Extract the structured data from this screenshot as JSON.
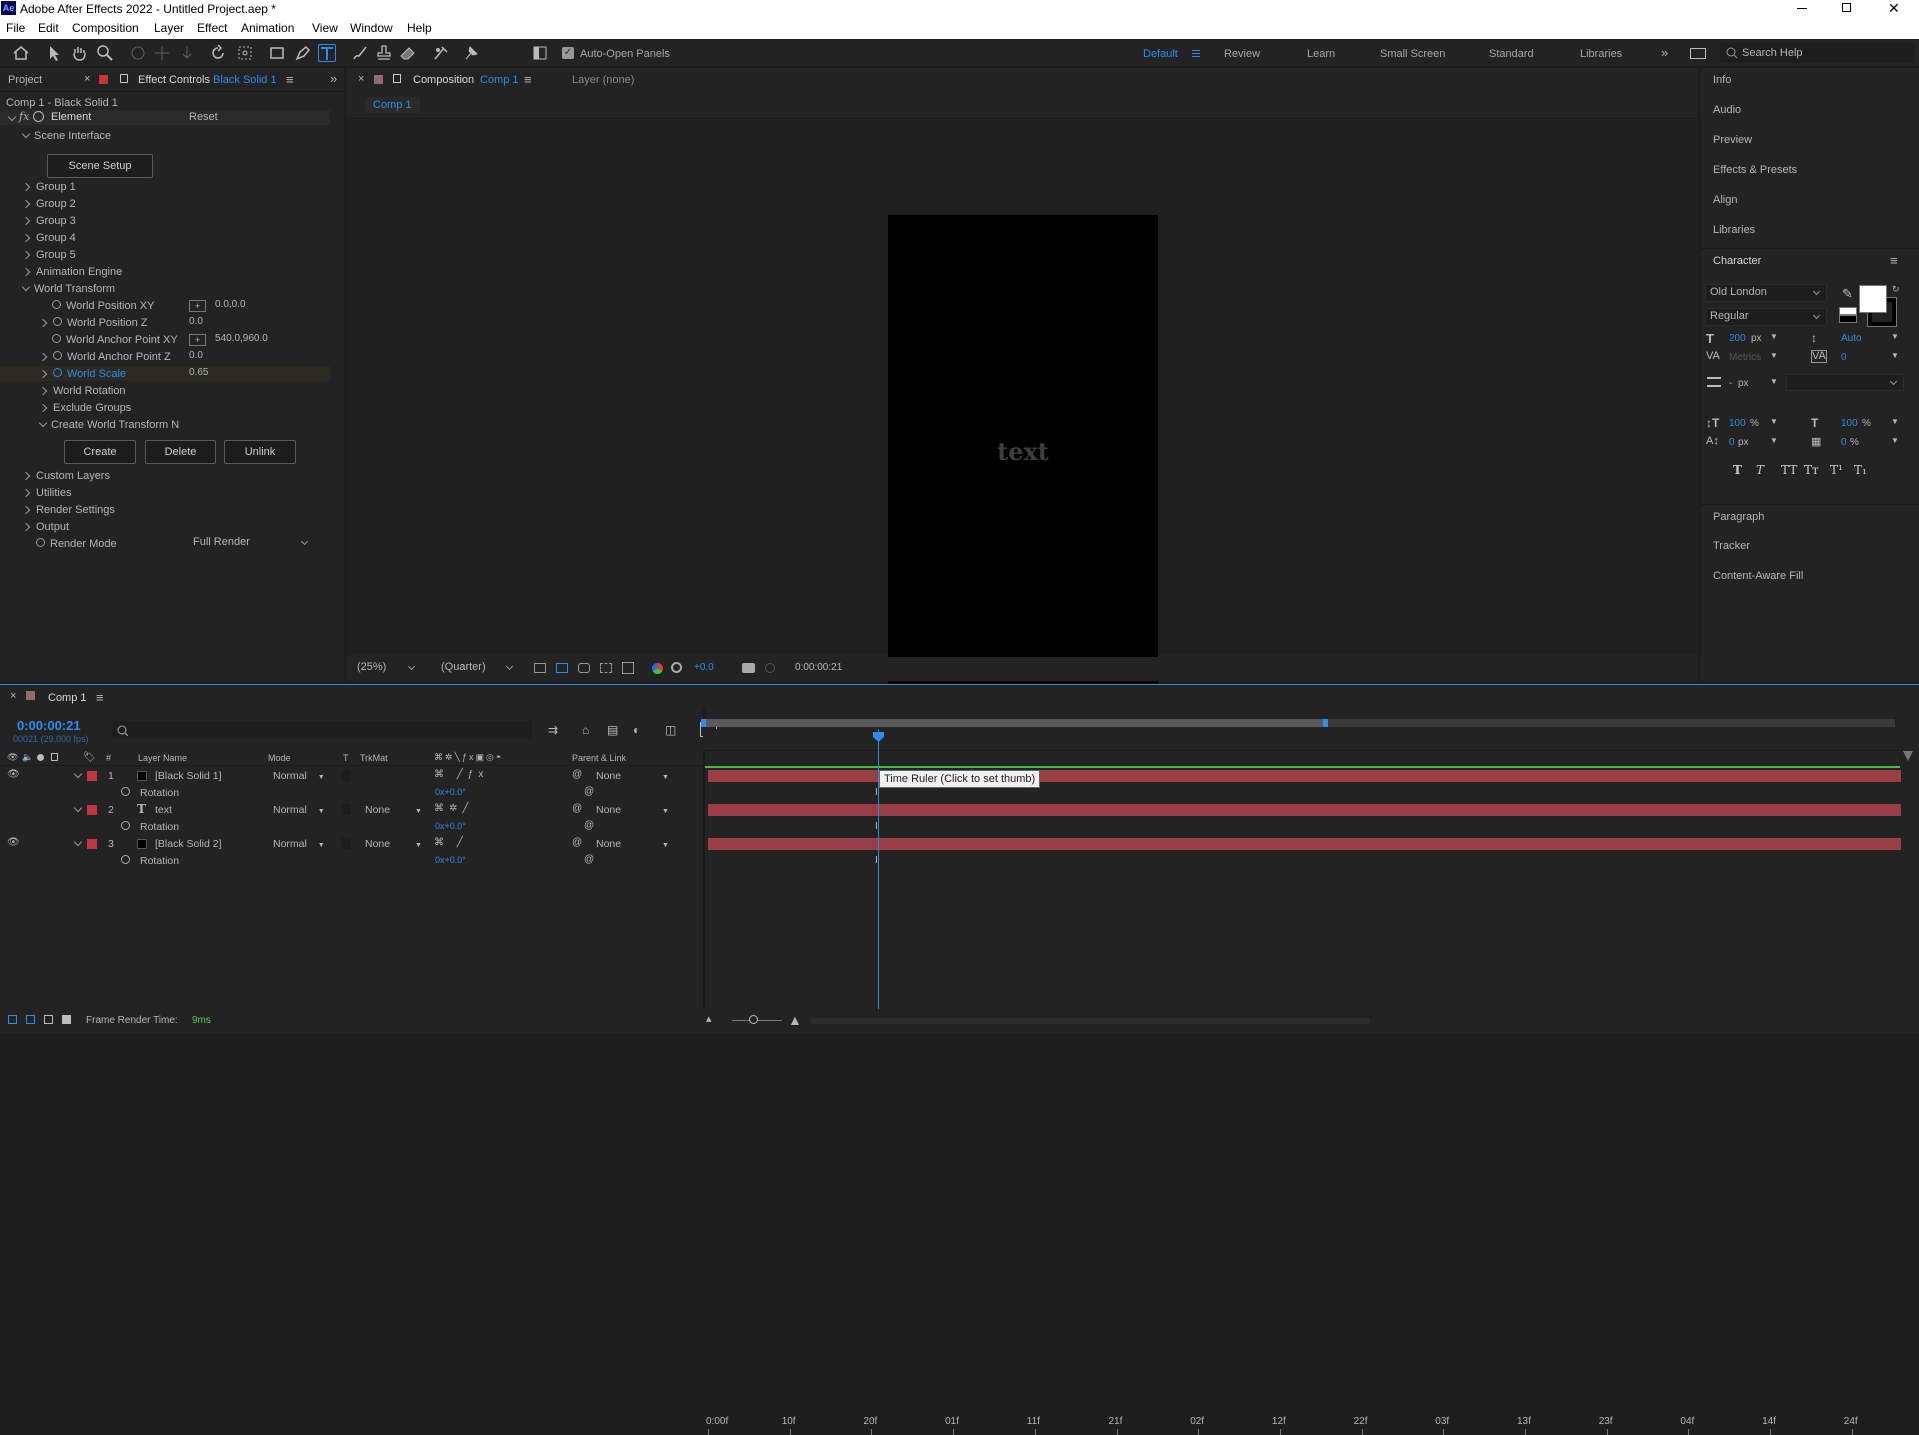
{
  "window": {
    "title": "Adobe After Effects 2022 - Untitled Project.aep *",
    "logo": "Ae"
  },
  "menu": [
    "File",
    "Edit",
    "Composition",
    "Layer",
    "Effect",
    "Animation",
    "View",
    "Window",
    "Help"
  ],
  "toolbar": {
    "auto_open_panels": "Auto-Open Panels",
    "workspaces": [
      "Default",
      "Review",
      "Learn",
      "Small Screen",
      "Standard",
      "Libraries"
    ],
    "search_help": "Search Help"
  },
  "effect_controls": {
    "tab_project": "Project",
    "tab_effect_controls": "Effect Controls",
    "tab_layer": "Black Solid 1",
    "breadcrumb": "Comp 1 - Black Solid 1",
    "effect_name": "Element",
    "reset": "Reset",
    "scene_interface": "Scene Interface",
    "scene_setup": "Scene Setup",
    "groups": [
      "Group 1",
      "Group 2",
      "Group 3",
      "Group 4",
      "Group 5"
    ],
    "animation_engine": "Animation Engine",
    "world_transform": "World Transform",
    "props": [
      {
        "label": "World Position XY",
        "value": "0.0,0.0"
      },
      {
        "label": "World Position Z",
        "value": "0.0"
      },
      {
        "label": "World Anchor Point XY",
        "value": "540.0,960.0"
      },
      {
        "label": "World Anchor Point Z",
        "value": "0.0"
      },
      {
        "label": "World Scale",
        "value": "0.65"
      }
    ],
    "world_rotation": "World Rotation",
    "exclude_groups": "Exclude Groups",
    "create_world_transform": "Create World Transform N",
    "buttons": [
      "Create",
      "Delete",
      "Unlink"
    ],
    "custom_layers": "Custom Layers",
    "utilities": "Utilities",
    "render_settings": "Render Settings",
    "output": "Output",
    "render_mode_label": "Render Mode",
    "render_mode_value": "Full Render"
  },
  "composition": {
    "tab_label": "Composition",
    "comp_name": "Comp 1",
    "layer_tab": "Layer (none)",
    "breadcrumb": "Comp 1",
    "preview_text": "text",
    "zoom": "(25%)",
    "resolution": "(Quarter)",
    "exposure": "+0.0",
    "timecode": "0:00:00:21"
  },
  "right_panels": [
    "Info",
    "Audio",
    "Preview",
    "Effects & Presets",
    "Align",
    "Libraries"
  ],
  "character": {
    "title": "Character",
    "font": "Old London",
    "style": "Regular",
    "size": "200",
    "size_unit": "px",
    "leading": "Auto",
    "kerning": "Metrics",
    "tracking": "0",
    "stroke_width": "-",
    "stroke_unit": "px",
    "vscale": "100",
    "hscale": "100",
    "pct": "%",
    "baseline": "0",
    "baseline_unit": "px",
    "tsume": "0",
    "styles": [
      "T",
      "T",
      "TT",
      "Tт",
      "T¹",
      "T₁"
    ],
    "fill_color": "#ffffff",
    "stroke_color": "#000000"
  },
  "bottom_panels": [
    "Paragraph",
    "Tracker",
    "Content-Aware Fill"
  ],
  "timeline": {
    "tab": "Comp 1",
    "timecode": "0:00:00:21",
    "frame_info": "00021 (29.000 fps)",
    "search_placeholder": "",
    "columns": {
      "num": "#",
      "layer_name": "Layer Name",
      "mode": "Mode",
      "t": "T",
      "trkmat": "TrkMat",
      "parent": "Parent & Link"
    },
    "layers": [
      {
        "num": "1",
        "name": "[Black Solid 1]",
        "mode": "Normal",
        "trkmat": "",
        "parent": "None",
        "prop": "Rotation",
        "prop_value": "0x+0.0°",
        "type": "solid"
      },
      {
        "num": "2",
        "name": "text",
        "mode": "Normal",
        "trkmat": "None",
        "parent": "None",
        "prop": "Rotation",
        "prop_value": "0x+0.0°",
        "type": "text"
      },
      {
        "num": "3",
        "name": "[Black Solid 2]",
        "mode": "Normal",
        "trkmat": "None",
        "parent": "None",
        "prop": "Rotation",
        "prop_value": "0x+0.0°",
        "type": "solid"
      }
    ],
    "ruler": [
      "0:00f",
      "10f",
      "20f",
      "01f",
      "11f",
      "21f",
      "02f",
      "12f",
      "22f",
      "03f",
      "13f",
      "23f",
      "04f",
      "14f",
      "24f"
    ],
    "tooltip": "Time Ruler (Click to set thumb)",
    "render_time_label": "Frame Render Time:",
    "render_time_value": "9ms",
    "label_color": "#c0373f",
    "bar_color": "#9a3e46"
  }
}
